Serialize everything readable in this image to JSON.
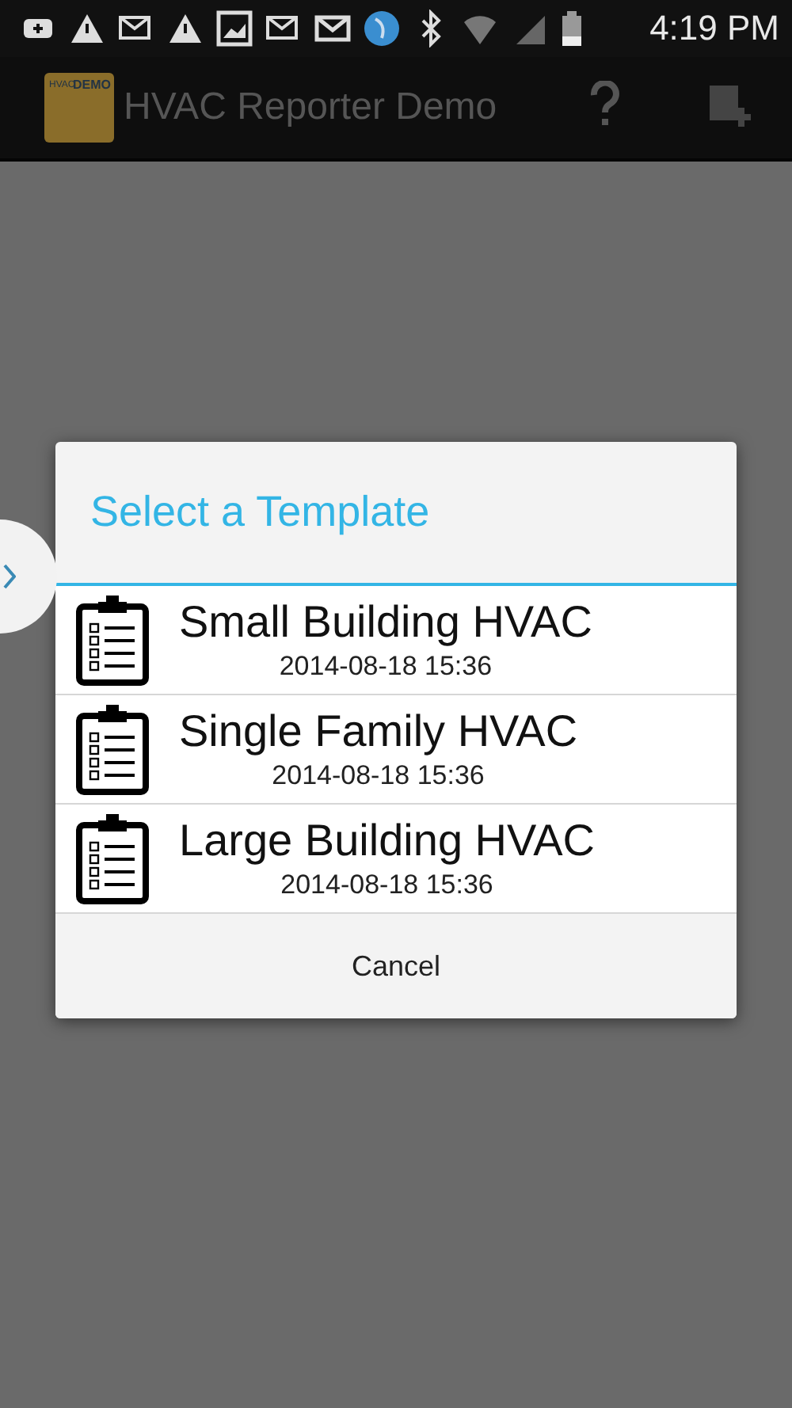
{
  "status_bar": {
    "time": "4:19 PM"
  },
  "action_bar": {
    "logo": {
      "top": "HVAC",
      "side": "DEMO"
    },
    "title": "HVAC Reporter Demo"
  },
  "dialog": {
    "title": "Select a Template",
    "items": [
      {
        "name": "Small Building HVAC",
        "date": "2014-08-18 15:36"
      },
      {
        "name": "Single Family HVAC",
        "date": "2014-08-18 15:36"
      },
      {
        "name": "Large Building HVAC",
        "date": "2014-08-18 15:36"
      }
    ],
    "cancel": "Cancel"
  }
}
